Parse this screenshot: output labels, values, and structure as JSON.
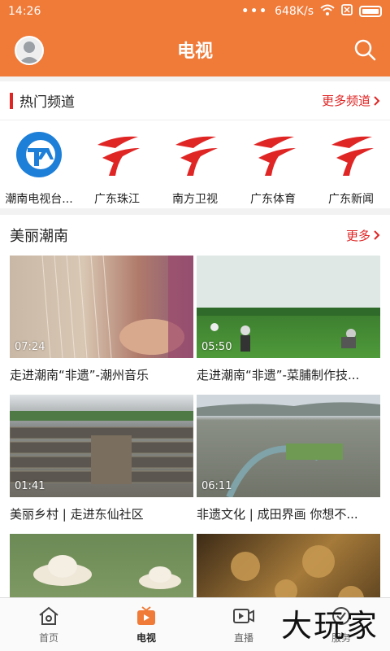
{
  "status": {
    "time": "14:26",
    "network": "648K/s",
    "dots": "•••"
  },
  "header": {
    "title": "电视"
  },
  "hot": {
    "title": "热门频道",
    "more_label": "更多频道",
    "channels": [
      {
        "label": "潮南电视台..."
      },
      {
        "label": "广东珠江"
      },
      {
        "label": "南方卫视"
      },
      {
        "label": "广东体育"
      },
      {
        "label": "广东新闻"
      }
    ]
  },
  "section": {
    "title": "美丽潮南",
    "more_label": "更多",
    "videos": [
      {
        "title": "走进潮南“非遗”-潮州音乐",
        "duration": "07:24"
      },
      {
        "title": "走进潮南“非遗”-菜脯制作技...",
        "duration": "05:50"
      },
      {
        "title": "美丽乡村 | 走进东仙社区",
        "duration": "01:41"
      },
      {
        "title": "非遗文化 | 成田界画 你想不...",
        "duration": "06:11"
      },
      {
        "title": "",
        "duration": ""
      },
      {
        "title": "",
        "duration": ""
      }
    ]
  },
  "tabs": [
    {
      "label": "首页",
      "icon": "home-icon"
    },
    {
      "label": "电视",
      "icon": "tv-icon"
    },
    {
      "label": "直播",
      "icon": "live-icon"
    },
    {
      "label": "服务",
      "icon": "service-icon"
    }
  ],
  "watermark": "大玩家",
  "colors": {
    "brand": "#f07a38",
    "accent_red": "#e02525"
  }
}
